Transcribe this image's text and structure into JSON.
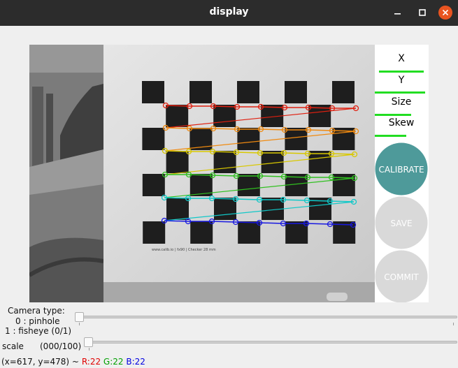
{
  "window": {
    "title": "display"
  },
  "panel": {
    "x_label": "X",
    "y_label": "Y",
    "size_label": "Size",
    "skew_label": "Skew",
    "calibrate_label": "CALIBRATE",
    "save_label": "SAVE",
    "commit_label": "COMMIT"
  },
  "chart_print": "www.calib.io | fx90 | Checker 28 mm",
  "controls": {
    "camera_type": {
      "line1": "Camera type:",
      "line2": "0 : pinhole",
      "line3": "1 : fisheye (0/1)",
      "value_fraction": 0
    },
    "scale": {
      "label": "scale",
      "value_text": "(000/100)",
      "value_fraction": 0
    }
  },
  "status_bar": {
    "coords": "(x=617, y=478) ~",
    "r": "R:22",
    "g": "G:22",
    "b": "B:22"
  },
  "colors": {
    "calibrate": "#4e9a9a",
    "disabled": "#d9d9d9",
    "bar_green": "#22dd22",
    "close": "#e95420",
    "rows": [
      "#e02010",
      "#f08a10",
      "#d8c800",
      "#30c020",
      "#10c8c8",
      "#1818e0"
    ]
  }
}
